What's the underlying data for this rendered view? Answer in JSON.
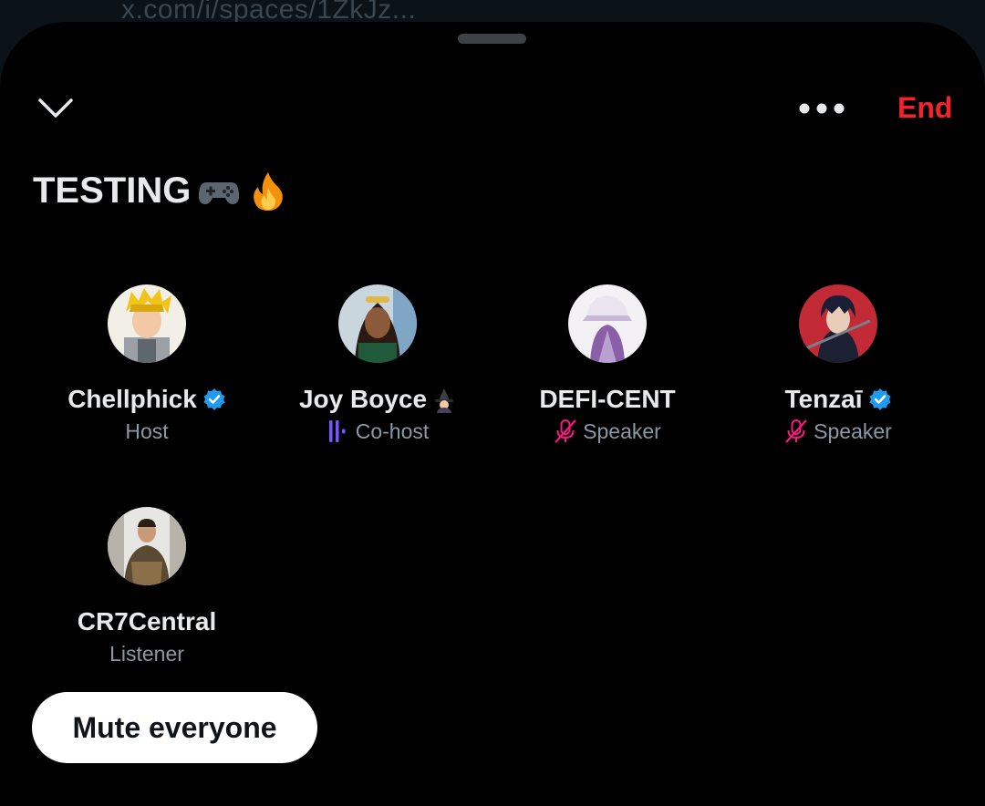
{
  "browser": {
    "url": "x.com/i/spaces/1ZkJz..."
  },
  "header": {
    "collapse_icon": "chevron-down-icon",
    "more_icon": "more-horizontal-icon",
    "end_label": "End",
    "end_color": "#f4212e"
  },
  "space": {
    "title": "TESTING",
    "title_emojis": [
      "game-controller-emoji",
      "fire-emoji"
    ]
  },
  "participants": [
    {
      "name": "Chellphick",
      "verified": true,
      "role": "Host",
      "role_icon": "",
      "name_emoji": ""
    },
    {
      "name": "Joy Boyce",
      "verified": false,
      "role": "Co-host",
      "role_icon": "speaking-bars-icon",
      "name_emoji": "witch-emoji"
    },
    {
      "name": "DEFI-CENT",
      "verified": false,
      "role": "Speaker",
      "role_icon": "mic-muted-icon",
      "name_emoji": ""
    },
    {
      "name": "Tenzaī",
      "verified": true,
      "role": "Speaker",
      "role_icon": "mic-muted-icon",
      "name_emoji": ""
    },
    {
      "name": "CR7Central",
      "verified": false,
      "role": "Listener",
      "role_icon": "",
      "name_emoji": ""
    }
  ],
  "actions": {
    "mute_everyone_label": "Mute everyone"
  },
  "colors": {
    "verified_badge": "#1d9bf0",
    "speaking_indicator": "#7856ff",
    "muted_mic": "#f91880"
  }
}
